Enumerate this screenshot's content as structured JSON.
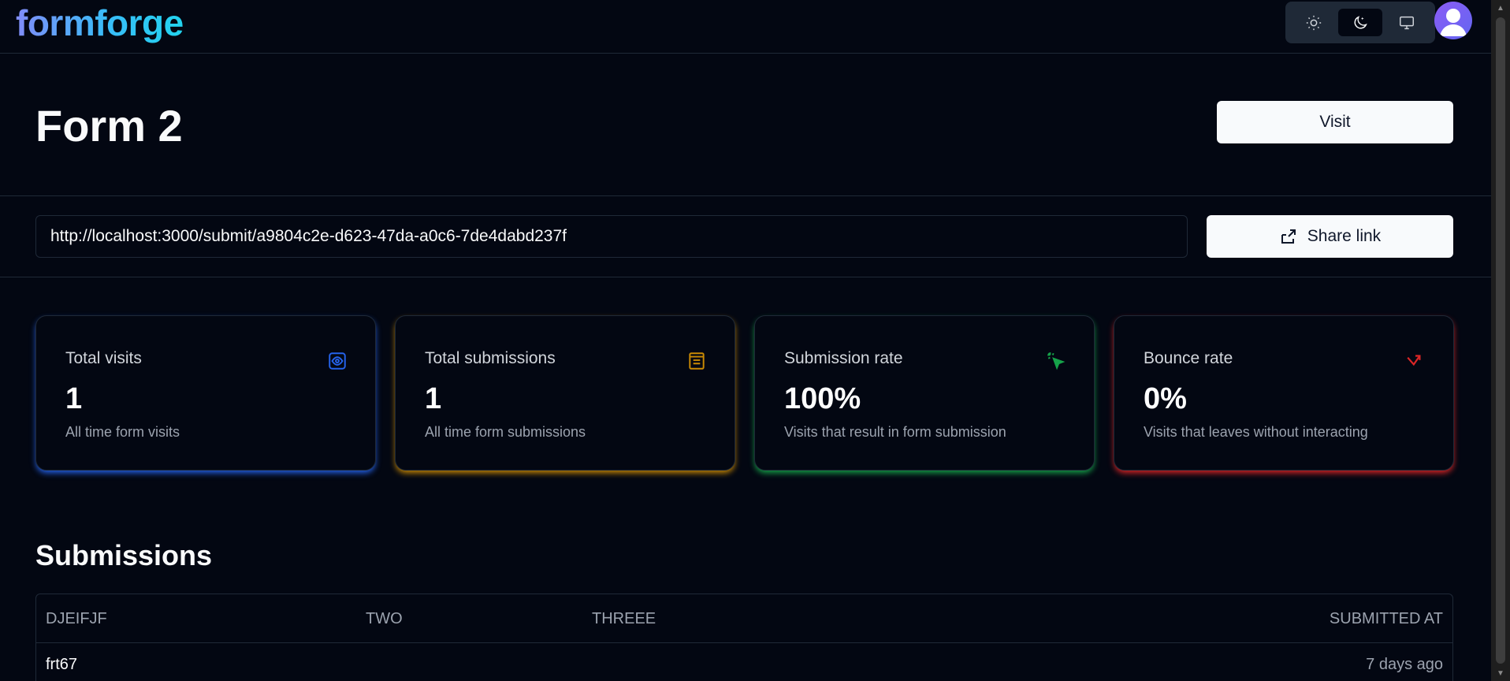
{
  "app": {
    "logo": "formforge"
  },
  "theme": {
    "options": [
      "sun-icon",
      "moon-icon",
      "monitor-icon"
    ],
    "active": "moon-icon"
  },
  "header": {
    "title": "Form 2",
    "visit_label": "Visit"
  },
  "share": {
    "url": "http://localhost:3000/submit/a9804c2e-d623-47da-a0c6-7de4dabd237f",
    "button_label": "Share link"
  },
  "stats": [
    {
      "title": "Total visits",
      "value": "1",
      "desc": "All time form visits",
      "icon": "eye-icon",
      "color": "#2563eb"
    },
    {
      "title": "Total submissions",
      "value": "1",
      "desc": "All time form submissions",
      "icon": "form-icon",
      "color": "#ca8a04"
    },
    {
      "title": "Submission rate",
      "value": "100%",
      "desc": "Visits that result in form submission",
      "icon": "cursor-click-icon",
      "color": "#16a34a"
    },
    {
      "title": "Bounce rate",
      "value": "0%",
      "desc": "Visits that leaves without interacting",
      "icon": "bounce-arrow-icon",
      "color": "#dc2626"
    }
  ],
  "submissions": {
    "heading": "Submissions",
    "columns": [
      "DJEIFJF",
      "TWO",
      "THREEE",
      "SUBMITTED AT"
    ],
    "rows": [
      {
        "cells": [
          "frt67",
          "",
          ""
        ],
        "submitted_at": "7 days ago"
      }
    ]
  }
}
